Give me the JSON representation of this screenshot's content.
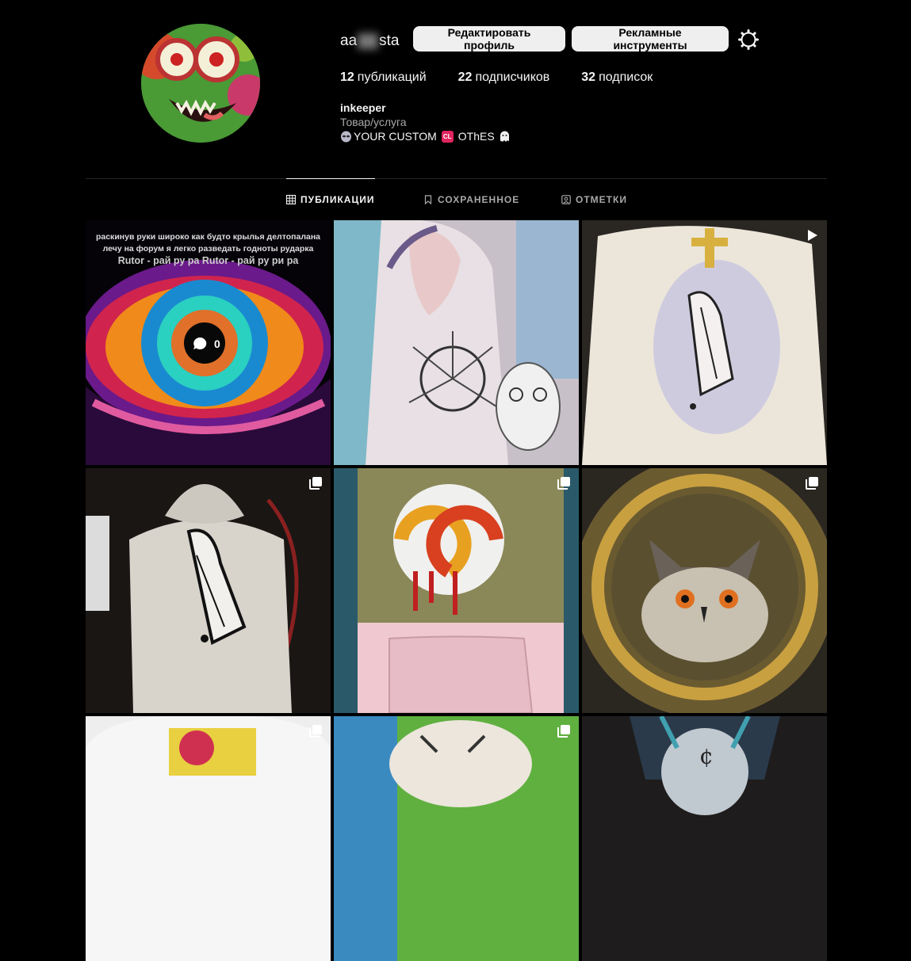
{
  "profile": {
    "username_visible_start": "aa",
    "username_visible_end": "sta",
    "edit_button": "Редактировать профиль",
    "ads_button": "Рекламные инструменты",
    "stats": [
      {
        "count": "12",
        "label": "публикаций"
      },
      {
        "count": "22",
        "label": "подписчиков"
      },
      {
        "count": "32",
        "label": "подписок"
      }
    ],
    "bio_name": "inkeeper",
    "bio_category": "Товар/услуга",
    "bio_text_1": "YOUR CUSTOM",
    "bio_badge": "CL",
    "bio_text_2": "OThES"
  },
  "tabs": [
    {
      "label": "ПУБЛИКАЦИИ",
      "active": true,
      "icon": "grid-icon"
    },
    {
      "label": "СОХРАНЕННОЕ",
      "active": false,
      "icon": "bookmark-icon"
    },
    {
      "label": "ОТМЕТКИ",
      "active": false,
      "icon": "tag-icon"
    }
  ],
  "posts": [
    {
      "id": "post-1",
      "overlay_line_1": "раскинув руки широко как будто крылья делтопалана",
      "overlay_line_2": "лечу на форум я легко разведать годноты рударка",
      "overlay_line_3": "Rutor - рай ру ра   Rutor - рай ру ри ра",
      "comments": "0"
    },
    {
      "id": "post-2",
      "badge": "none"
    },
    {
      "id": "post-3",
      "badge": "reel-icon"
    },
    {
      "id": "post-4",
      "badge": "carousel-icon"
    },
    {
      "id": "post-5",
      "badge": "carousel-icon"
    },
    {
      "id": "post-6",
      "badge": "carousel-icon"
    },
    {
      "id": "post-7",
      "badge": "carousel-icon"
    },
    {
      "id": "post-8",
      "badge": "carousel-icon"
    },
    {
      "id": "post-9",
      "badge": "none"
    }
  ],
  "colors": {
    "background": "#000000",
    "text": "#f5f5f5",
    "secondary_text": "#a8a8a8",
    "button_bg": "#efefef",
    "divider": "#262626"
  }
}
